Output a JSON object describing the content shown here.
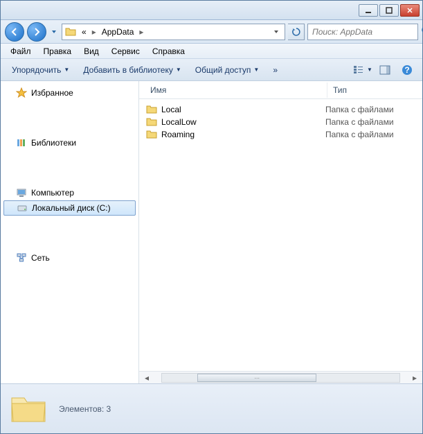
{
  "titlebar": {},
  "nav": {
    "breadcrumb_root": "«",
    "breadcrumb_current": "AppData"
  },
  "search": {
    "placeholder": "Поиск: AppData"
  },
  "menu": {
    "file": "Файл",
    "edit": "Правка",
    "view": "Вид",
    "tools": "Сервис",
    "help": "Справка"
  },
  "toolbar": {
    "organize": "Упорядочить",
    "addlib": "Добавить в библиотеку",
    "share": "Общий доступ",
    "more": "»"
  },
  "sidebar": {
    "favorites": "Избранное",
    "libraries": "Библиотеки",
    "computer": "Компьютер",
    "local_disk": "Локальный диск (C:)",
    "network": "Сеть"
  },
  "columns": {
    "name": "Имя",
    "type": "Тип"
  },
  "files": [
    {
      "name": "Local",
      "type": "Папка с файлами"
    },
    {
      "name": "LocalLow",
      "type": "Папка с файлами"
    },
    {
      "name": "Roaming",
      "type": "Папка с файлами"
    }
  ],
  "status": {
    "text": "Элементов: 3"
  }
}
